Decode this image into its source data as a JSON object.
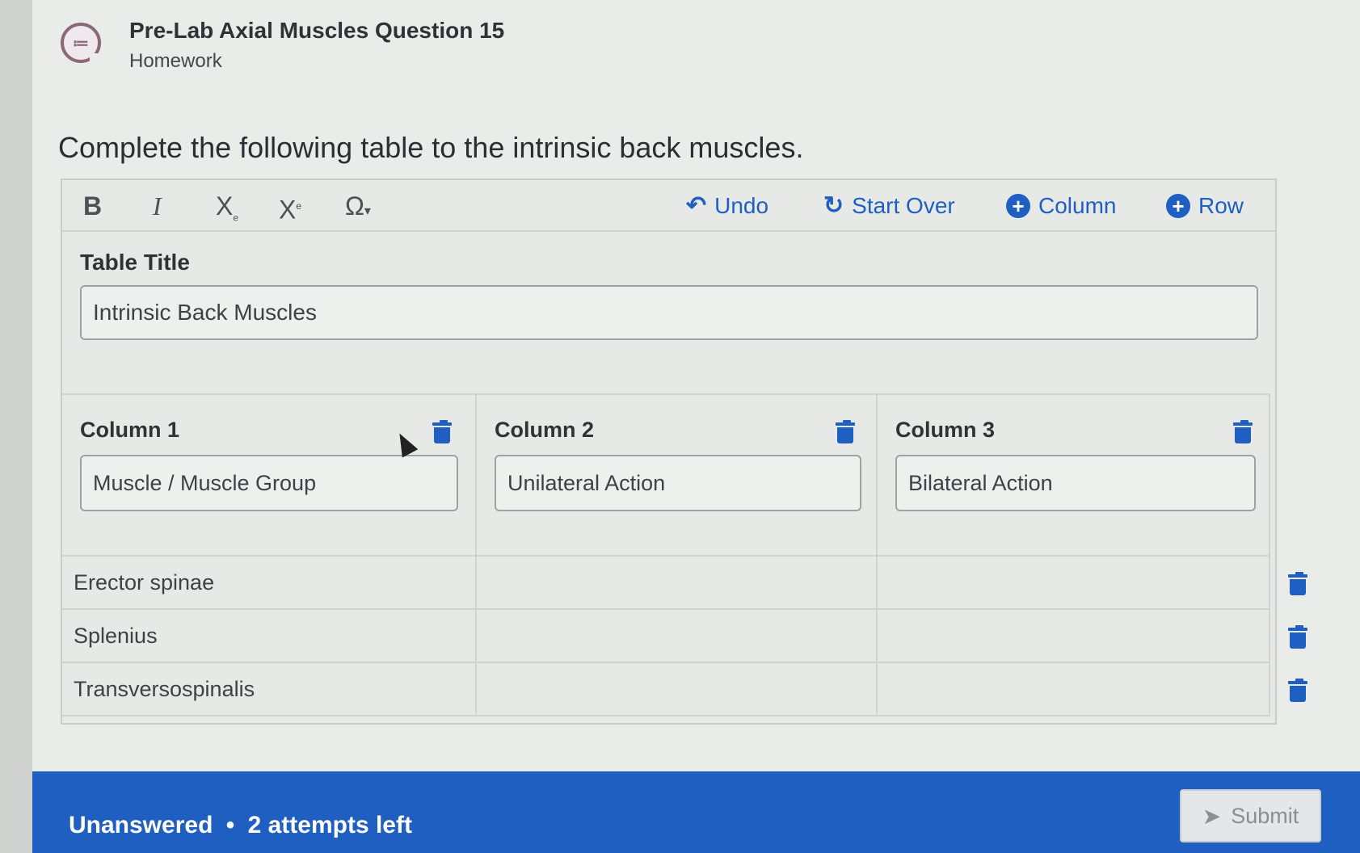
{
  "header": {
    "title": "Pre-Lab Axial Muscles Question 15",
    "subtitle": "Homework",
    "icon": "list-chat-icon"
  },
  "prompt": "Complete the following table to the intrinsic back muscles.",
  "toolbar": {
    "bold": "B",
    "italic": "I",
    "subscript": "X",
    "superscript": "X",
    "special_chars": "Ω",
    "undo_label": "Undo",
    "start_over_label": "Start Over",
    "add_column_label": "Column",
    "add_row_label": "Row"
  },
  "table_title": {
    "label": "Table Title",
    "value": "Intrinsic Back Muscles"
  },
  "columns": [
    {
      "label": "Column 1",
      "value": "Muscle / Muscle Group"
    },
    {
      "label": "Column 2",
      "value": "Unilateral Action"
    },
    {
      "label": "Column 3",
      "value": "Bilateral Action"
    }
  ],
  "rows": [
    {
      "cells": [
        "Erector spinae",
        "",
        ""
      ]
    },
    {
      "cells": [
        "Splenius",
        "",
        ""
      ]
    },
    {
      "cells": [
        "Transversospinalis",
        "",
        ""
      ]
    }
  ],
  "footer": {
    "status": "Unanswered",
    "separator": "•",
    "attempts": "2 attempts left",
    "submit_label": "Submit"
  },
  "colors": {
    "accent": "#1f5fc2",
    "background": "#e9ece9"
  }
}
